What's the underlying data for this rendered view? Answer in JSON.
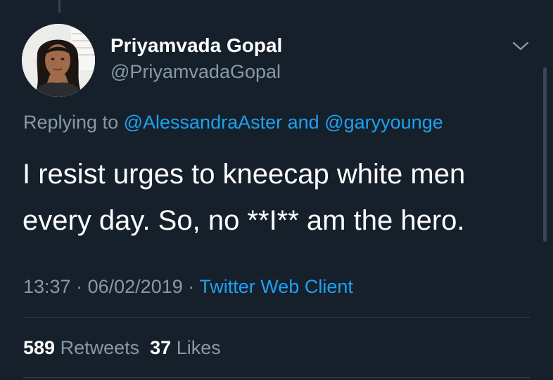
{
  "tweet": {
    "author": {
      "display_name": "Priyamvada Gopal",
      "handle": "@PriyamvadaGopal",
      "avatar_icon": "profile-photo"
    },
    "reply": {
      "prefix": "Replying to",
      "mention_1": "@AlessandraAster",
      "conjunction": "and",
      "mention_2": "@garyyounge"
    },
    "text_lines": [
      "I resist urges to kneecap white men",
      "every day. So, no **I** am the hero."
    ],
    "meta": {
      "time": "13:37",
      "separator": "·",
      "date": "06/02/2019",
      "source": "Twitter Web Client"
    },
    "stats": {
      "retweets_count": "589",
      "retweets_label": "Retweets",
      "likes_count": "37",
      "likes_label": "Likes"
    }
  },
  "theme": {
    "background": "#15202b",
    "link": "#1da1f2",
    "muted": "#8899a6",
    "divider": "#38444d"
  },
  "icons": {
    "menu": "chevron-down-icon"
  }
}
